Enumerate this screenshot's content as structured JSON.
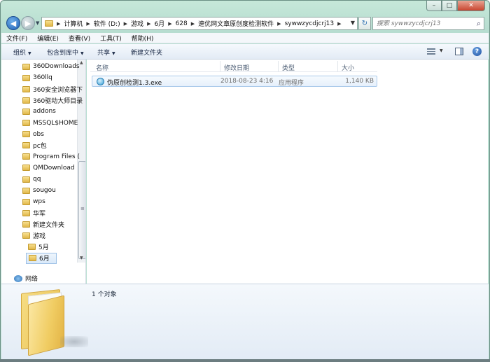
{
  "window": {
    "caption_buttons": {
      "minimize": "–",
      "maximize": "□",
      "close": "✕"
    }
  },
  "address": {
    "crumbs": [
      "计算机",
      "软件 (D:)",
      "游戏",
      "6月",
      "628",
      "速优网文章原创度检测软件",
      "sywwzycdjcrj13"
    ],
    "search_placeholder": "搜索 sywwzycdjcrj13"
  },
  "menu": [
    "文件(F)",
    "编辑(E)",
    "查看(V)",
    "工具(T)",
    "帮助(H)"
  ],
  "toolbar": {
    "organize": "组织",
    "include_library": "包含到库中",
    "share": "共享",
    "new_folder": "新建文件夹"
  },
  "tree": [
    {
      "label": "360Downloads",
      "indent": 0
    },
    {
      "label": "360llq",
      "indent": 0
    },
    {
      "label": "360安全浏览器下",
      "indent": 0
    },
    {
      "label": "360驱动大师目录",
      "indent": 0
    },
    {
      "label": "addons",
      "indent": 0
    },
    {
      "label": "MSSQL$HOME",
      "indent": 0
    },
    {
      "label": "obs",
      "indent": 0
    },
    {
      "label": "pc包",
      "indent": 0
    },
    {
      "label": "Program Files (",
      "indent": 0
    },
    {
      "label": "QMDownload",
      "indent": 0
    },
    {
      "label": "qq",
      "indent": 0
    },
    {
      "label": "sougou",
      "indent": 0
    },
    {
      "label": "wps",
      "indent": 0
    },
    {
      "label": "华军",
      "indent": 0
    },
    {
      "label": "新建文件夹",
      "indent": 0
    },
    {
      "label": "游戏",
      "indent": 0
    },
    {
      "label": "5月",
      "indent": 1
    },
    {
      "label": "6月",
      "indent": 1,
      "selected": true
    }
  ],
  "network_label": "网络",
  "columns": {
    "name": "名称",
    "date": "修改日期",
    "type": "类型",
    "size": "大小"
  },
  "files": [
    {
      "name": "伪原创检测1.3.exe",
      "date": "2018-08-23 4:16",
      "type": "应用程序",
      "size": "1,140 KB",
      "icon": "application-icon"
    }
  ],
  "status": {
    "count": "1 个对象"
  }
}
